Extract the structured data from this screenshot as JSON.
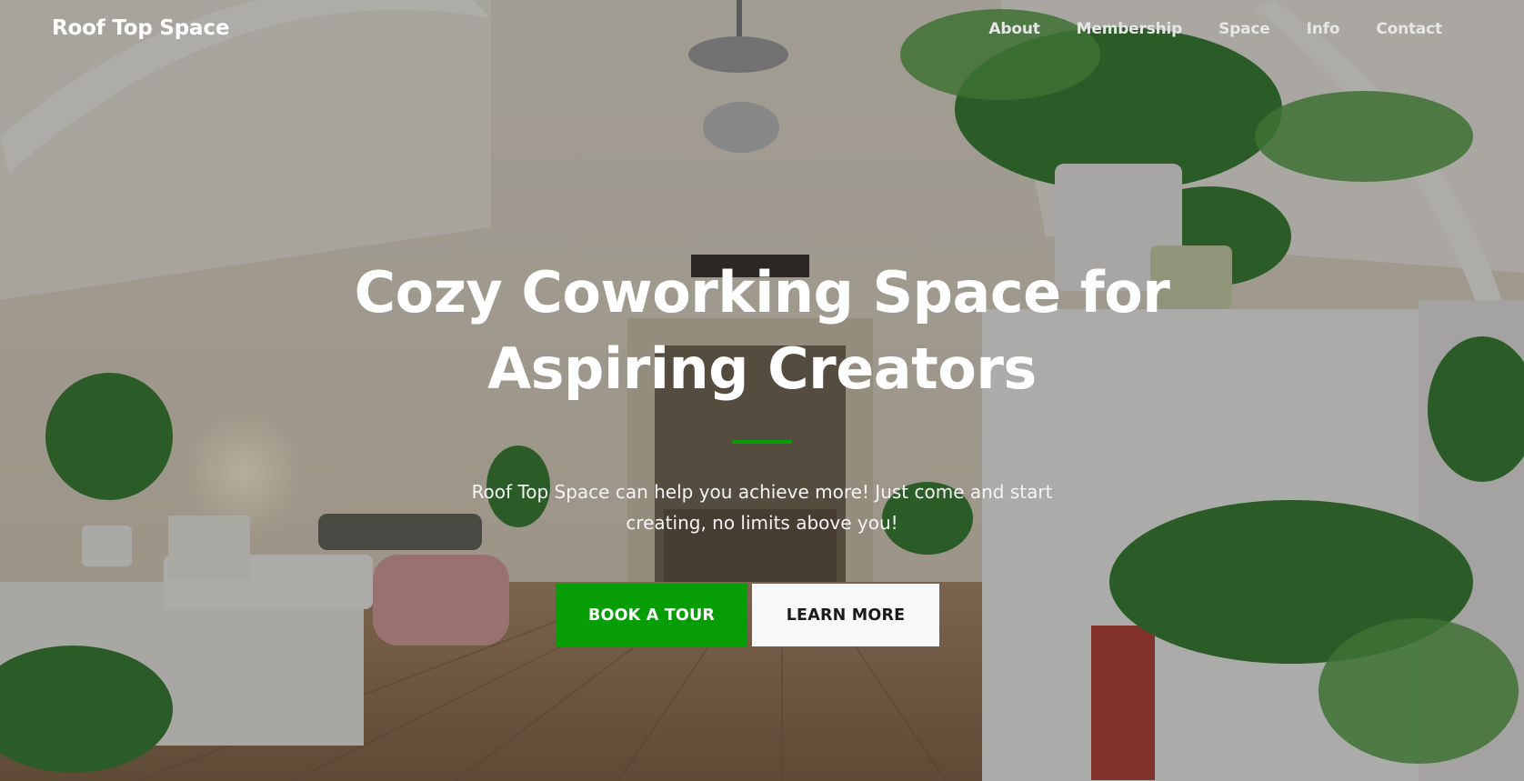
{
  "brand": {
    "name": "Roof Top Space"
  },
  "nav": {
    "items": [
      {
        "label": "About"
      },
      {
        "label": "Membership"
      },
      {
        "label": "Space"
      },
      {
        "label": "Info"
      },
      {
        "label": "Contact"
      }
    ]
  },
  "hero": {
    "title": "Cozy Coworking Space for Aspiring Creators",
    "subtitle": "Roof Top Space can help you achieve more! Just come and start creating, no limits above you!",
    "primary_button": "BOOK A TOUR",
    "secondary_button": "LEARN MORE"
  },
  "colors": {
    "accent": "#079d07",
    "text": "#ffffff",
    "secondary_button_bg": "#f8f9fa"
  },
  "icons": {
    "background": "coworking-interior-photo"
  }
}
